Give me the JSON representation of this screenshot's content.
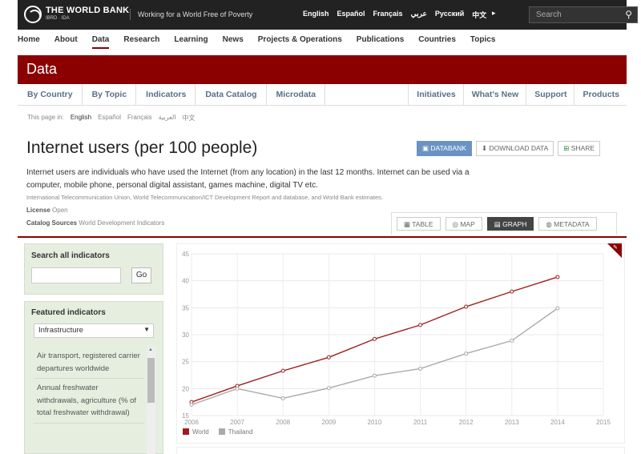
{
  "topbar": {
    "logo_main": "THE WORLD BANK",
    "logo_sub": "IBRD · IDA",
    "tagline": "Working for a World Free of Poverty",
    "languages": [
      "English",
      "Español",
      "Français",
      "عربي",
      "Русский",
      "中文"
    ],
    "search_placeholder": "Search"
  },
  "main_nav": [
    "Home",
    "About",
    "Data",
    "Research",
    "Learning",
    "News",
    "Projects & Operations",
    "Publications",
    "Countries",
    "Topics"
  ],
  "section_title": "Data",
  "sub_nav": {
    "left": [
      "By Country",
      "By Topic",
      "Indicators",
      "Data Catalog",
      "Microdata"
    ],
    "right": [
      "Initiatives",
      "What's New",
      "Support",
      "Products"
    ]
  },
  "page_in": {
    "label": "This page in:",
    "languages": [
      "English",
      "Español",
      "Français",
      "العربية",
      "中文"
    ]
  },
  "indicator": {
    "title": "Internet users (per 100 people)",
    "description": "Internet users are individuals who have used the Internet (from any location) in the last 12 months. Internet can be used via a computer, mobile phone, personal digital assistant, games machine, digital TV etc.",
    "source": "International Telecommunication Union, World Telecommunication/ICT Development Report and database, and World Bank estimates.",
    "license_label": "License",
    "license_value": "Open",
    "catalog_label": "Catalog Sources",
    "catalog_value": "World Development Indicators"
  },
  "actions": [
    "DATABANK",
    "DOWNLOAD DATA",
    "SHARE"
  ],
  "view_tabs": [
    "TABLE",
    "MAP",
    "GRAPH",
    "METADATA"
  ],
  "sidebar": {
    "search_label": "Search all indicators",
    "go_label": "Go",
    "featured_label": "Featured indicators",
    "featured_select": "Infrastructure",
    "featured_items": [
      "Air transport, registered carrier departures worldwide",
      "Annual freshwater withdrawals, agriculture (% of total freshwater withdrawal)"
    ]
  },
  "chart_data": {
    "type": "line",
    "x": [
      2006,
      2007,
      2008,
      2009,
      2010,
      2011,
      2012,
      2013,
      2014
    ],
    "x_ticks": [
      2006,
      2007,
      2008,
      2009,
      2010,
      2011,
      2012,
      2013,
      2014,
      2015
    ],
    "y_ticks": [
      15,
      20,
      25,
      30,
      35,
      40,
      45
    ],
    "ylim": [
      15,
      45
    ],
    "xlim": [
      2006,
      2015
    ],
    "grid": true,
    "legend_position": "bottom-left",
    "series": [
      {
        "name": "World",
        "color": "#a01c1c",
        "values": [
          17.5,
          20.5,
          23.3,
          25.8,
          29.2,
          31.8,
          35.2,
          38.0,
          40.7
        ]
      },
      {
        "name": "Thailand",
        "color": "#aaaaaa",
        "values": [
          17.0,
          20.0,
          18.2,
          20.1,
          22.4,
          23.7,
          26.5,
          28.9,
          34.9
        ]
      }
    ]
  },
  "colors": {
    "brand_red": "#8b0000",
    "topbar": "#222222",
    "link_blue": "#5a6f8a"
  }
}
